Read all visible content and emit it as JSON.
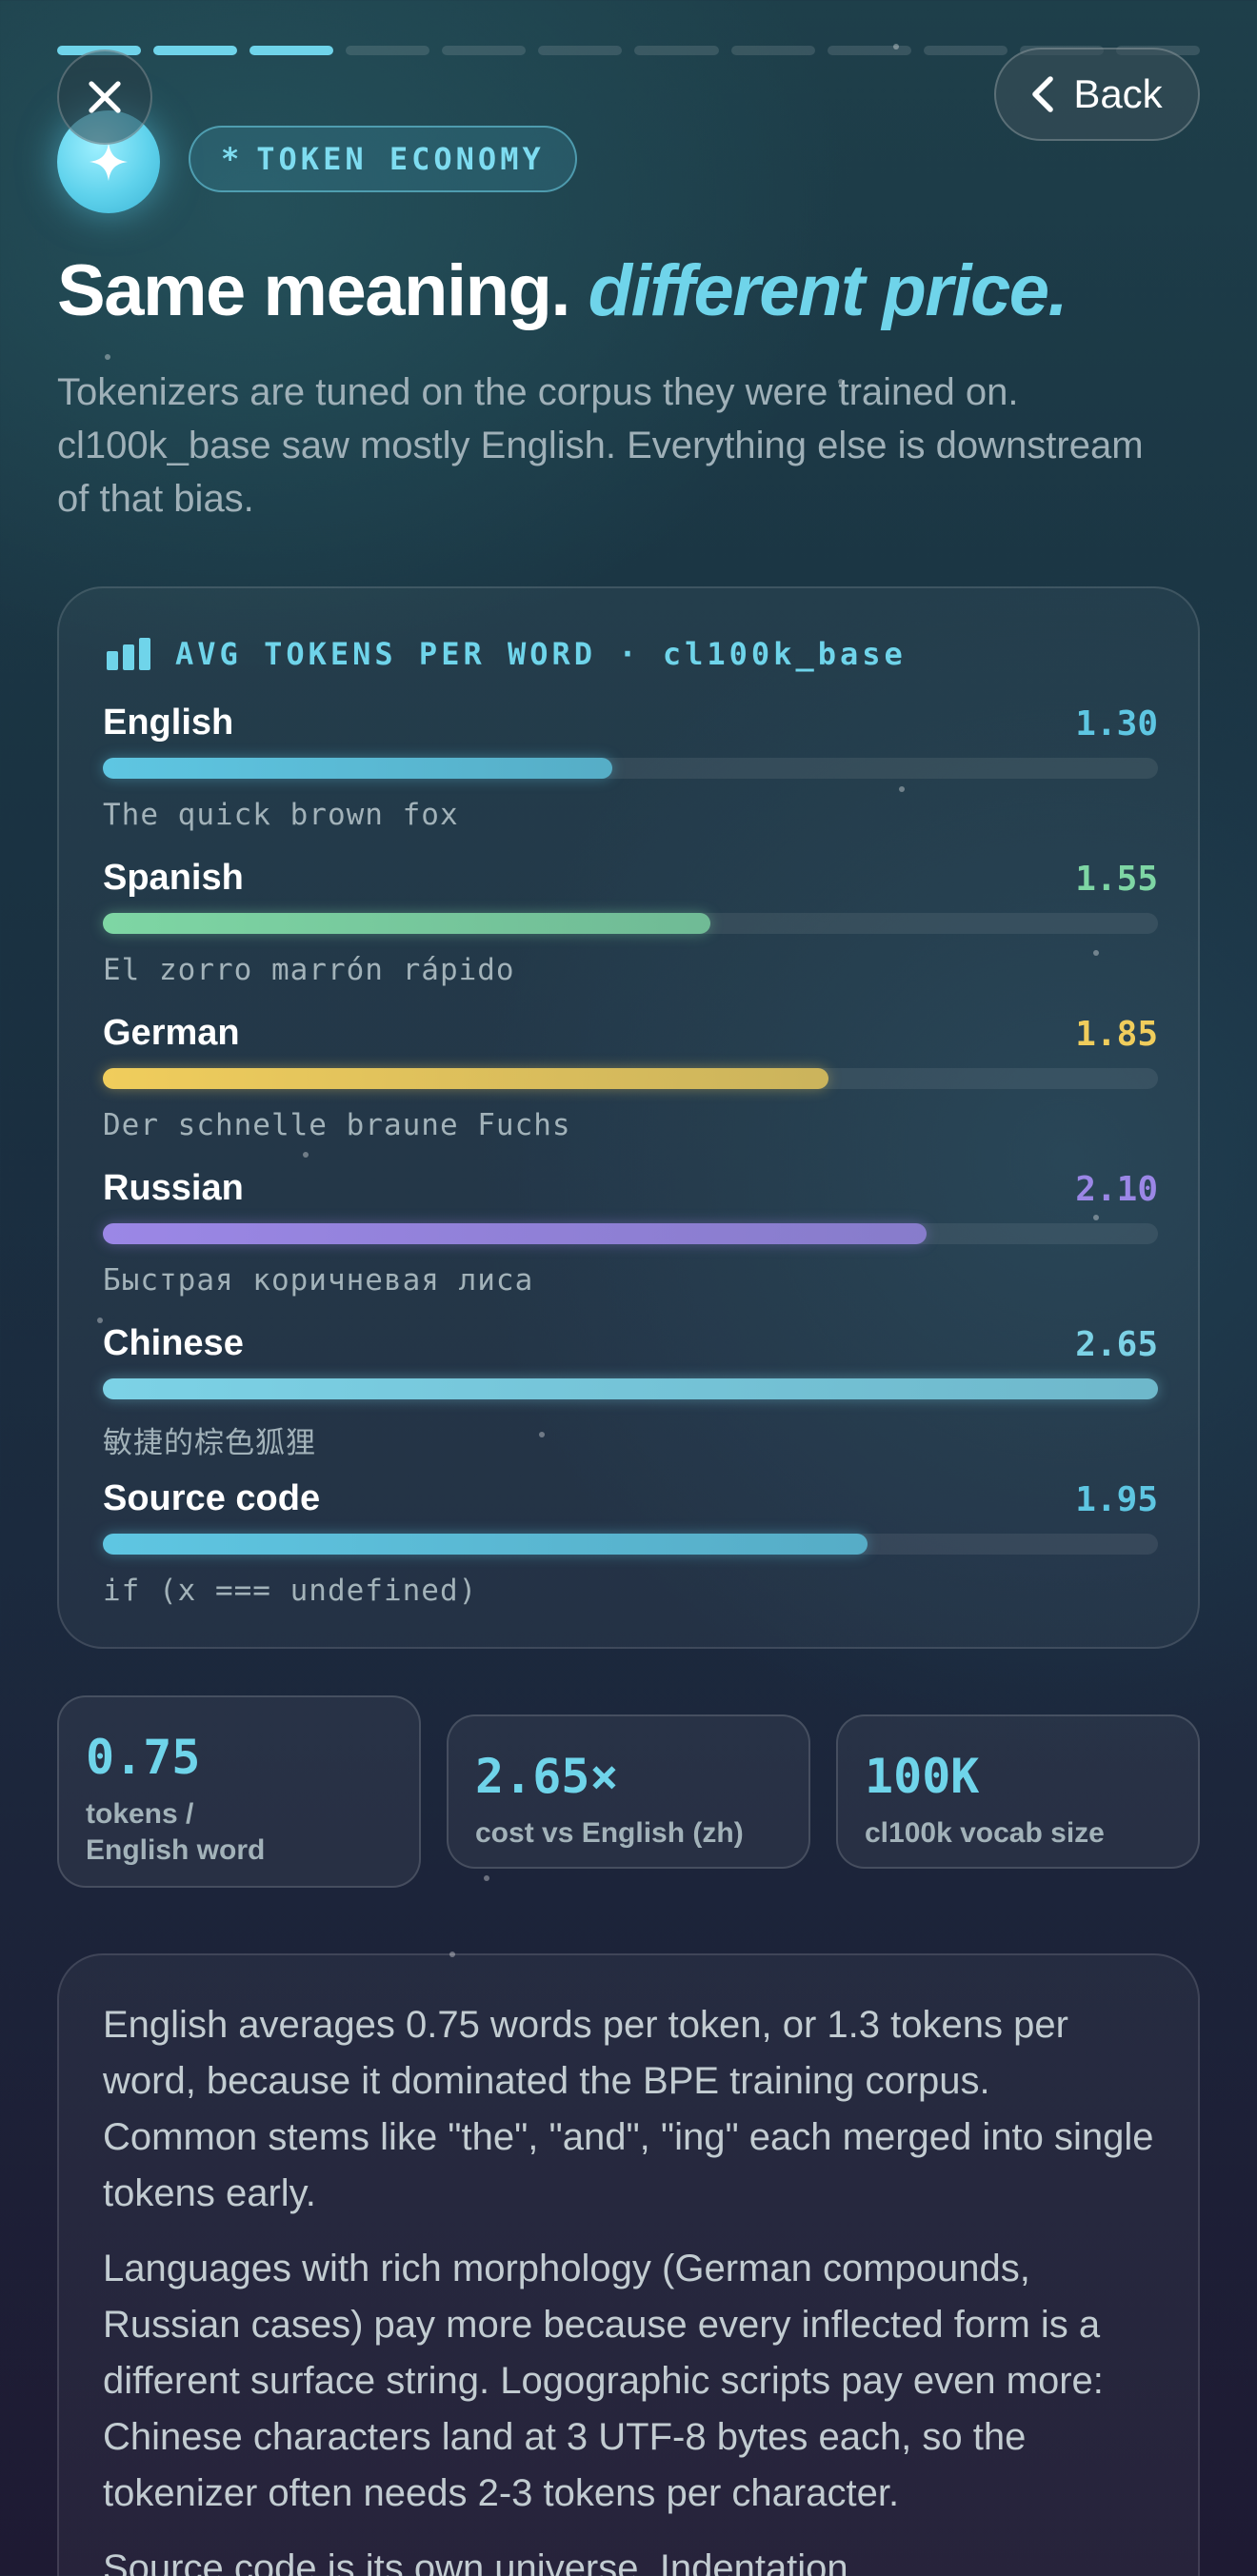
{
  "progress": {
    "total_steps": 12,
    "completed_steps": 3
  },
  "header": {
    "back_label": "Back",
    "tag_icon": "asterisk",
    "tag_label": "TOKEN ECONOMY",
    "orb_icon": "sparkle-icon"
  },
  "headline": {
    "main": "Same meaning.",
    "accent": "different price."
  },
  "subtitle": "Tokenizers are tuned on the corpus they were trained on. cl100k_base saw mostly English. Everything else is downstream of that bias.",
  "chart_card": {
    "title": "AVG TOKENS PER WORD · cl100k_base",
    "icon": "bar-chart-icon"
  },
  "chart_data": {
    "type": "bar",
    "title": "AVG TOKENS PER WORD · cl100k_base",
    "orientation": "horizontal",
    "xlim": [
      0,
      2.65
    ],
    "categories": [
      "English",
      "Spanish",
      "German",
      "Russian",
      "Chinese",
      "Source code"
    ],
    "values": [
      1.3,
      1.55,
      1.85,
      2.1,
      2.65,
      1.95
    ],
    "value_labels": [
      "1.30",
      "1.55",
      "1.85",
      "2.10",
      "2.65",
      "1.95"
    ],
    "samples": [
      "The quick brown fox",
      "El zorro marrón rápido",
      "Der schnelle braune Fuchs",
      "Быстрая коричневая лиса",
      "敏捷的棕色狐狸",
      "if (x === undefined)"
    ],
    "colors": [
      "#5ec6e2",
      "#7ed6a4",
      "#f0cd5c",
      "#9b87e6",
      "#7cd2e6",
      "#5ec6e2"
    ]
  },
  "stats": [
    {
      "value": "0.75",
      "label_line1": "tokens /",
      "label_line2": "English word"
    },
    {
      "value": "2.65×",
      "label_line1": "cost vs English (zh)",
      "label_line2": ""
    },
    {
      "value": "100K",
      "label_line1": "cl100k vocab size",
      "label_line2": ""
    }
  ],
  "explanation": [
    "English averages 0.75 words per token, or 1.3 tokens per word, because it dominated the BPE training corpus. Common stems like \"the\", \"and\", \"ing\" each merged into single tokens early.",
    "Languages with rich morphology (German compounds, Russian cases) pay more because every inflected form is a different surface string. Logographic scripts pay even more: Chinese characters land at 3 UTF-8 bytes each, so the tokenizer often needs 2-3 tokens per character.",
    "Source code is its own universe. Indentation"
  ],
  "colors": {
    "accent": "#6fd4ea",
    "text_muted": "#9fb0b8"
  }
}
